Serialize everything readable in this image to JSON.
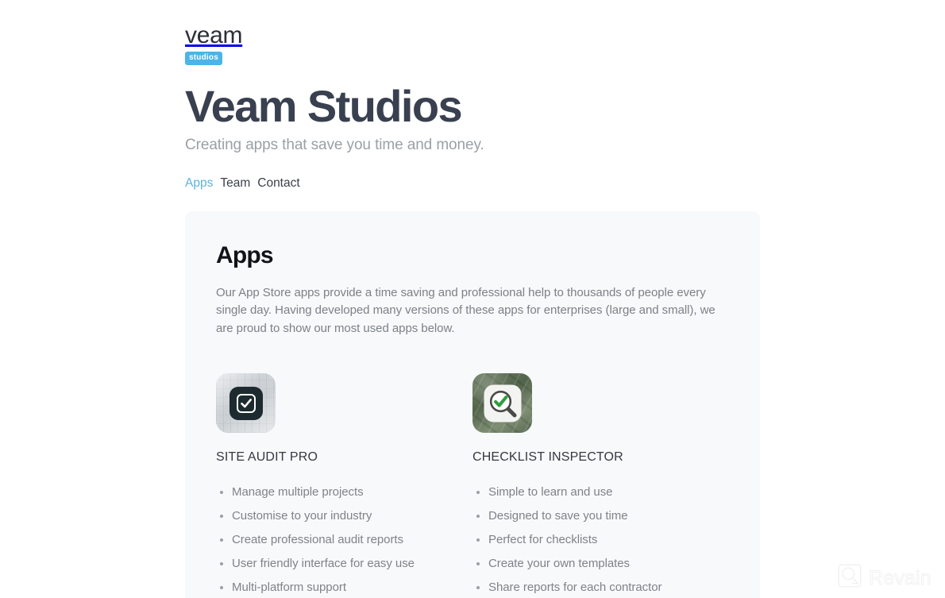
{
  "brand": {
    "logo_word": "veam",
    "logo_badge": "studios",
    "badge_color": "#4bb4e8"
  },
  "header": {
    "title": "Veam Studios",
    "tagline": "Creating apps that save you time and money.",
    "title_color": "#39404f",
    "tagline_color": "#9aa0a6"
  },
  "nav": {
    "items": [
      {
        "label": "Apps",
        "active": true
      },
      {
        "label": "Team",
        "active": false
      },
      {
        "label": "Contact",
        "active": false
      }
    ],
    "active_color": "#5ab4dd",
    "inactive_color": "#3c4149"
  },
  "card": {
    "background": "#f8f9fb",
    "title": "Apps",
    "intro": "Our App Store apps provide a time saving and professional help to thousands of people every single day. Having developed many versions of these apps for enterprises (large and small), we are proud to show our most used apps below."
  },
  "apps": [
    {
      "icon_name": "site-audit-pro-app-icon",
      "name": "SITE AUDIT PRO",
      "features": [
        "Manage multiple projects",
        "Customise to your industry",
        "Create professional audit reports",
        "User friendly interface for easy use",
        "Multi-platform support"
      ]
    },
    {
      "icon_name": "checklist-inspector-app-icon",
      "name": "CHECKLIST INSPECTOR",
      "features": [
        "Simple to learn and use",
        "Designed to save you time",
        "Perfect for checklists",
        "Create your own templates",
        "Share reports for each contractor"
      ]
    }
  ],
  "watermark": {
    "text": "Revain",
    "icon_name": "revain-logo-icon",
    "color": "#f0f1f3"
  }
}
